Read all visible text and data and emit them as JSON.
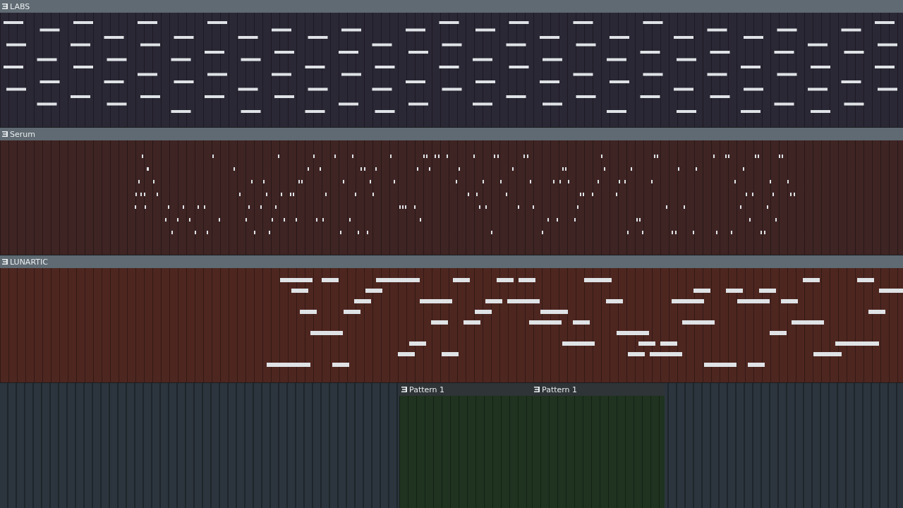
{
  "tracks": [
    {
      "kind": "notes",
      "title": "LABS",
      "color": "#2b2836"
    },
    {
      "kind": "notes",
      "title": "Serum",
      "color": "#3f2424"
    },
    {
      "kind": "notes",
      "title": "LUNARTIC",
      "color": "#4e2620"
    },
    {
      "kind": "lane",
      "clips": [
        {
          "title": "Pattern 1",
          "color": "#1f3320"
        },
        {
          "title": "Pattern 1",
          "color": "#1f3320"
        }
      ]
    }
  ]
}
